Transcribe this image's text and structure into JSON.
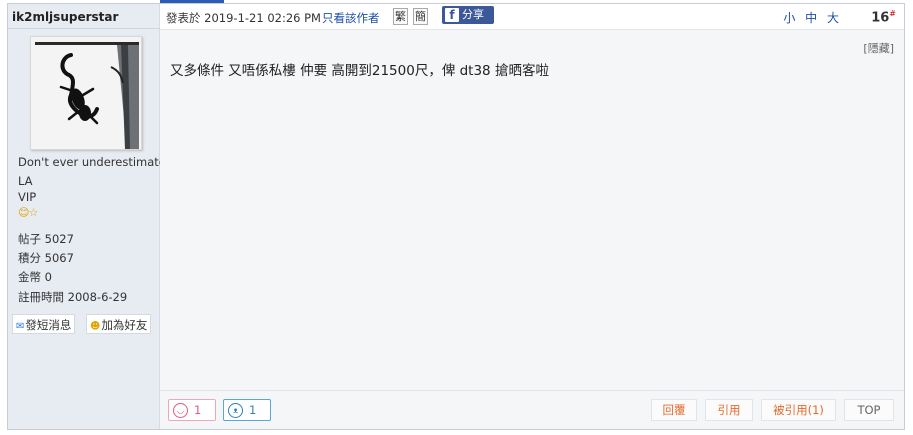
{
  "user": {
    "username": "ik2mljsuperstar",
    "signature": "Don't ever underestimate",
    "rank": "LA",
    "group": "VIP",
    "stars_icon": "smiley-star-icons",
    "stats": {
      "posts_label": "帖子",
      "posts": "5027",
      "points_label": "積分",
      "points": "5067",
      "coins_label": "金幣",
      "coins": "0",
      "reg_label": "註冊時間",
      "reg_date": "2008-6-29"
    },
    "pm_label": "發短消息",
    "add_friend_label": "加為好友"
  },
  "header": {
    "posted_label": "發表於",
    "posted_time": "2019-1-21 02:26 PM",
    "author_only_label": "只看該作者",
    "trad_label": "繁",
    "simp_label": "簡",
    "fb_share_label": "分享",
    "fb_icon": "f",
    "font_sizes": "小 中 大",
    "floor_number": "16",
    "floor_suffix": "#"
  },
  "post": {
    "hidden_label": "[隱藏]",
    "text": "又多條件  又唔係私樓  仲要  高開到21500尺，俾  dt38  搶晒客啦"
  },
  "footer": {
    "like_count": "1",
    "cat_count": "1",
    "reply_label": "回覆",
    "quote_label": "引用",
    "quoted_label": "被引用(1)",
    "top_label": "TOP"
  },
  "colors": {
    "sidebar_bg": "#e7ebf2",
    "link_blue": "#1f4ea8",
    "fb_blue": "#3b5998",
    "action_orange": "#e36b2a"
  }
}
